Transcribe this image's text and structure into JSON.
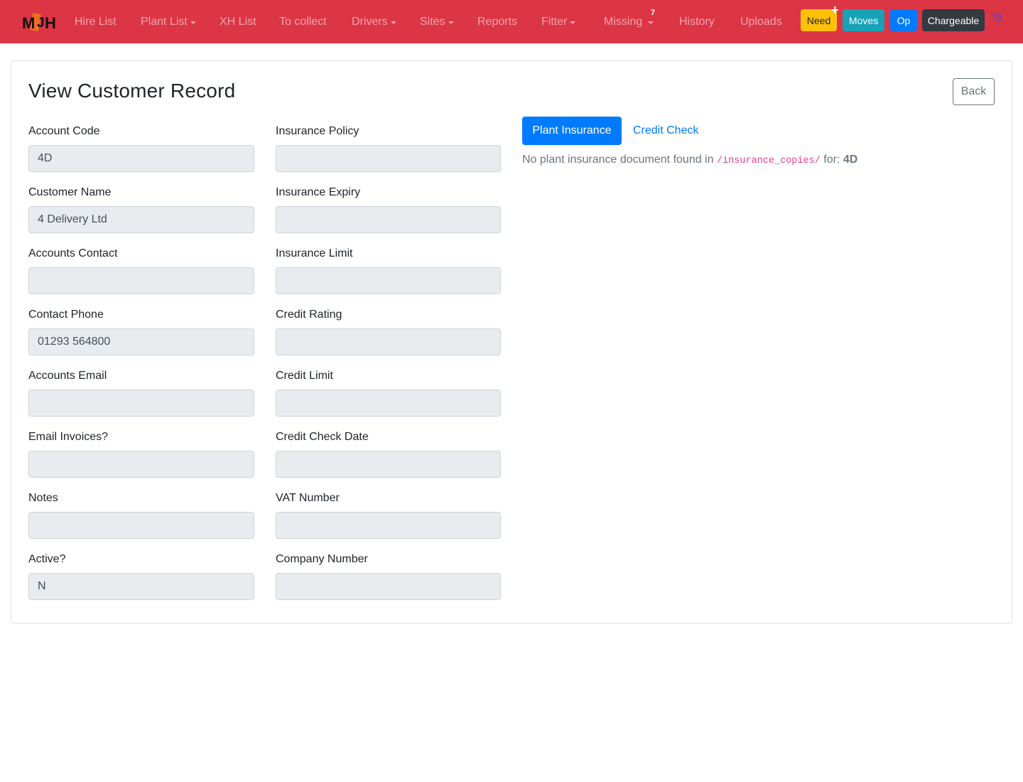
{
  "nav": {
    "brand": "MJH",
    "items": [
      {
        "label": "Hire List",
        "dropdown": false
      },
      {
        "label": "Plant List",
        "dropdown": true
      },
      {
        "label": "XH List",
        "dropdown": false
      },
      {
        "label": "To collect",
        "dropdown": false
      },
      {
        "label": "Drivers",
        "dropdown": true
      },
      {
        "label": "Sites",
        "dropdown": true
      },
      {
        "label": "Reports",
        "dropdown": false
      },
      {
        "label": "Fitter",
        "dropdown": true
      },
      {
        "label": "Missing",
        "dropdown": true,
        "badge": "7"
      },
      {
        "label": "History",
        "dropdown": false
      },
      {
        "label": "Uploads",
        "dropdown": false
      }
    ],
    "buttons": {
      "need": "Need",
      "moves": "Moves",
      "op": "Op",
      "chargeable": "Chargeable"
    },
    "icons": {
      "plus": "plus-icon",
      "history": "history-icon"
    }
  },
  "page": {
    "title": "View Customer Record",
    "back_label": "Back"
  },
  "form": {
    "left": [
      {
        "label": "Account Code",
        "value": "4D"
      },
      {
        "label": "Customer Name",
        "value": "4 Delivery Ltd"
      },
      {
        "label": "Accounts Contact",
        "value": ""
      },
      {
        "label": "Contact Phone",
        "value": "01293 564800"
      },
      {
        "label": "Accounts Email",
        "value": ""
      },
      {
        "label": "Email Invoices?",
        "value": ""
      },
      {
        "label": "Notes",
        "value": ""
      },
      {
        "label": "Active?",
        "value": "N"
      }
    ],
    "right": [
      {
        "label": "Insurance Policy",
        "value": ""
      },
      {
        "label": "Insurance Expiry",
        "value": ""
      },
      {
        "label": "Insurance Limit",
        "value": ""
      },
      {
        "label": "Credit Rating",
        "value": ""
      },
      {
        "label": "Credit Limit",
        "value": ""
      },
      {
        "label": "Credit Check Date",
        "value": ""
      },
      {
        "label": "VAT Number",
        "value": ""
      },
      {
        "label": "Company Number",
        "value": ""
      }
    ]
  },
  "tabs": {
    "active": "Plant Insurance",
    "other": "Credit Check",
    "message_prefix": "No plant insurance document found in",
    "message_path": "/insurance_copies/",
    "message_mid": "for:",
    "message_code": "4D"
  },
  "colors": {
    "navbar": "#dc3545",
    "need": "#ffc107",
    "moves": "#17a2b8",
    "op": "#007bff",
    "chargeable": "#343a40",
    "link": "#007bff",
    "code": "#e83e8c"
  }
}
